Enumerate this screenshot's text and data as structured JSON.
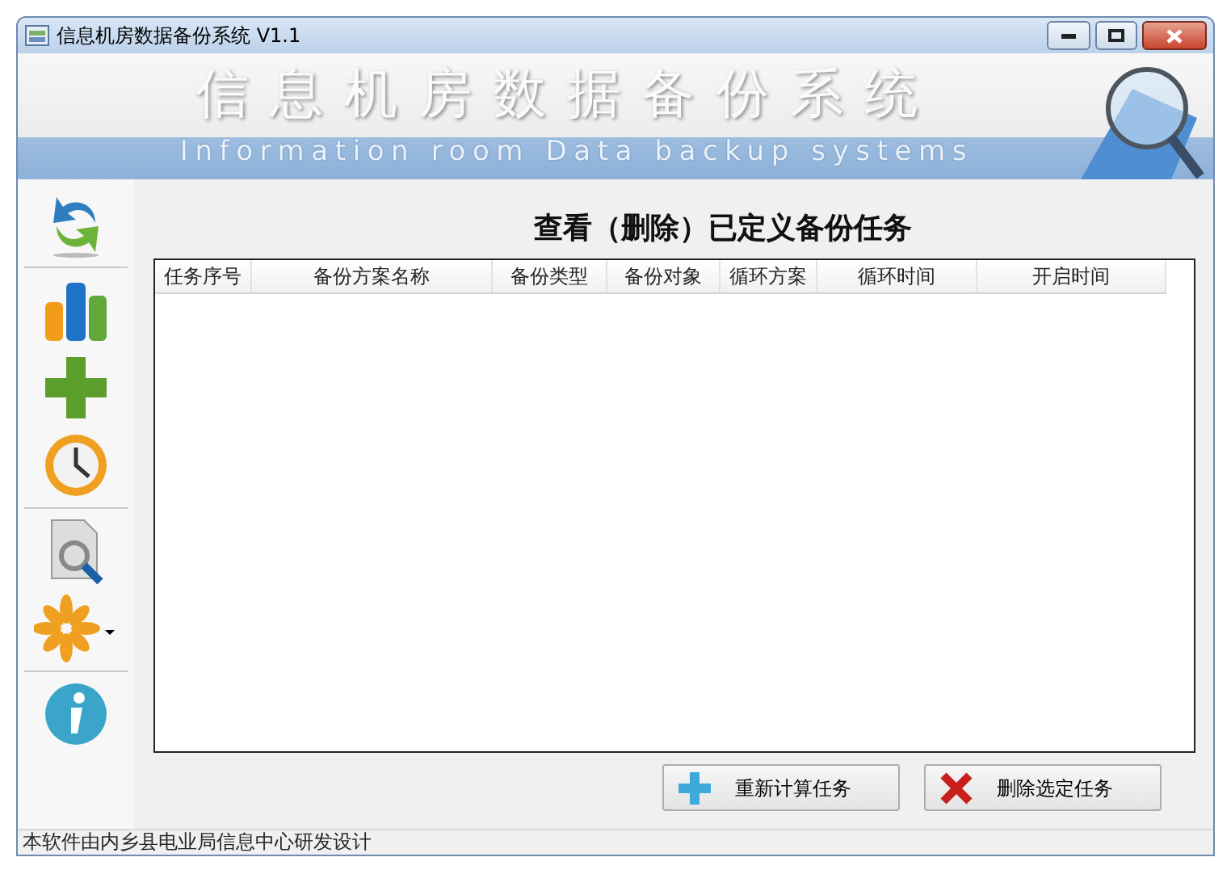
{
  "window": {
    "title": "信息机房数据备份系统 V1.1"
  },
  "banner": {
    "title": "信息机房数据备份系统",
    "subtitle": "Information room Data backup systems"
  },
  "page_title": "查看（删除）已定义备份任务",
  "table": {
    "columns": [
      "任务序号",
      "备份方案名称",
      "备份类型",
      "备份对象",
      "循环方案",
      "循环时间",
      "开启时间"
    ]
  },
  "buttons": [
    {
      "kind": "add",
      "label": "重新计算任务"
    },
    {
      "kind": "delete",
      "label": "删除选定任务"
    }
  ],
  "status_bar": "本软件由内乡县电业局信息中心研发设计"
}
